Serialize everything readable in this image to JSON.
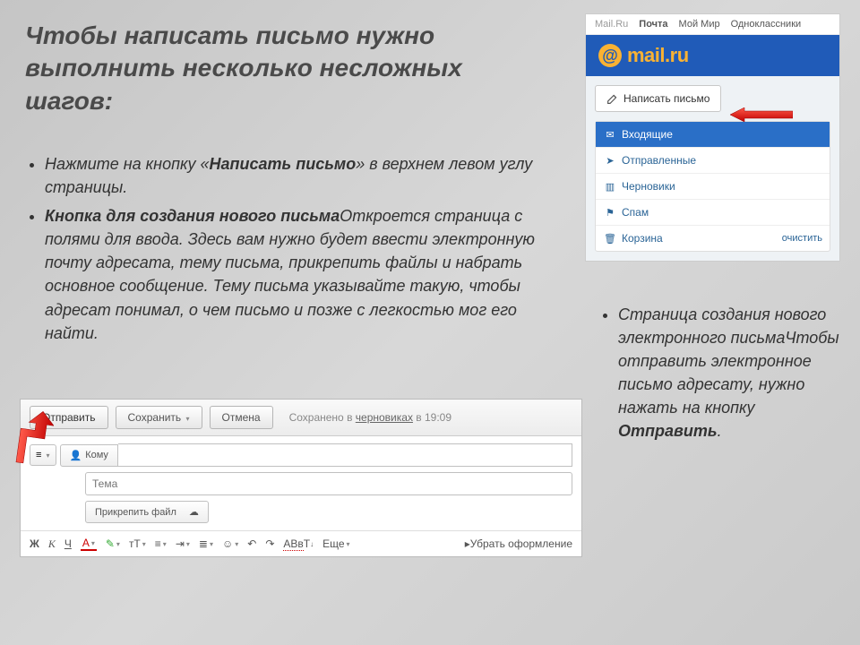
{
  "heading": "Чтобы написать письмо нужно выполнить несколько несложных шагов:",
  "bullets": {
    "b1_pre": "Нажмите на кнопку «",
    "b1_bold": "Написать письмо",
    "b1_post": "» в верхнем левом углу страницы.",
    "b2_bold": "Кнопка для создания нового письма",
    "b2_post": "Откроется страница с полями для ввода. Здесь вам нужно будет ввести электронную почту адресата, тему письма, прикрепить файлы и набрать основное сообщение. Тему письма указывайте такую, чтобы адресат понимал, о чем письмо и позже с легкостью мог его найти."
  },
  "right": {
    "italic": "Страница создания нового электронного письма",
    "rest": "Чтобы отправить электронное письмо адресату, нужно нажать на кнопку ",
    "bold": "Отправить",
    "dot": "."
  },
  "mail": {
    "nav": {
      "site": "Mail.Ru",
      "mail": "Почта",
      "world": "Мой Мир",
      "ok": "Одноклассники"
    },
    "logo": "mail.ru",
    "compose": "Написать письмо",
    "folders": {
      "inbox": "Входящие",
      "sent": "Отправленные",
      "drafts": "Черновики",
      "spam": "Спам",
      "trash": "Корзина",
      "clear": "очистить"
    }
  },
  "compose": {
    "send": "Отправить",
    "save": "Сохранить",
    "cancel": "Отмена",
    "saved_pre": "Сохранено в ",
    "saved_link": "черновиках",
    "saved_time": " в 19:09",
    "to_label": "Кому",
    "subject_placeholder": "Тема",
    "attach": "Прикрепить файл",
    "fmt": {
      "bold": "Ж",
      "italic": "К",
      "underline": "Ч",
      "more": "Еще",
      "clear_fmt": "Убрать оформление"
    }
  }
}
